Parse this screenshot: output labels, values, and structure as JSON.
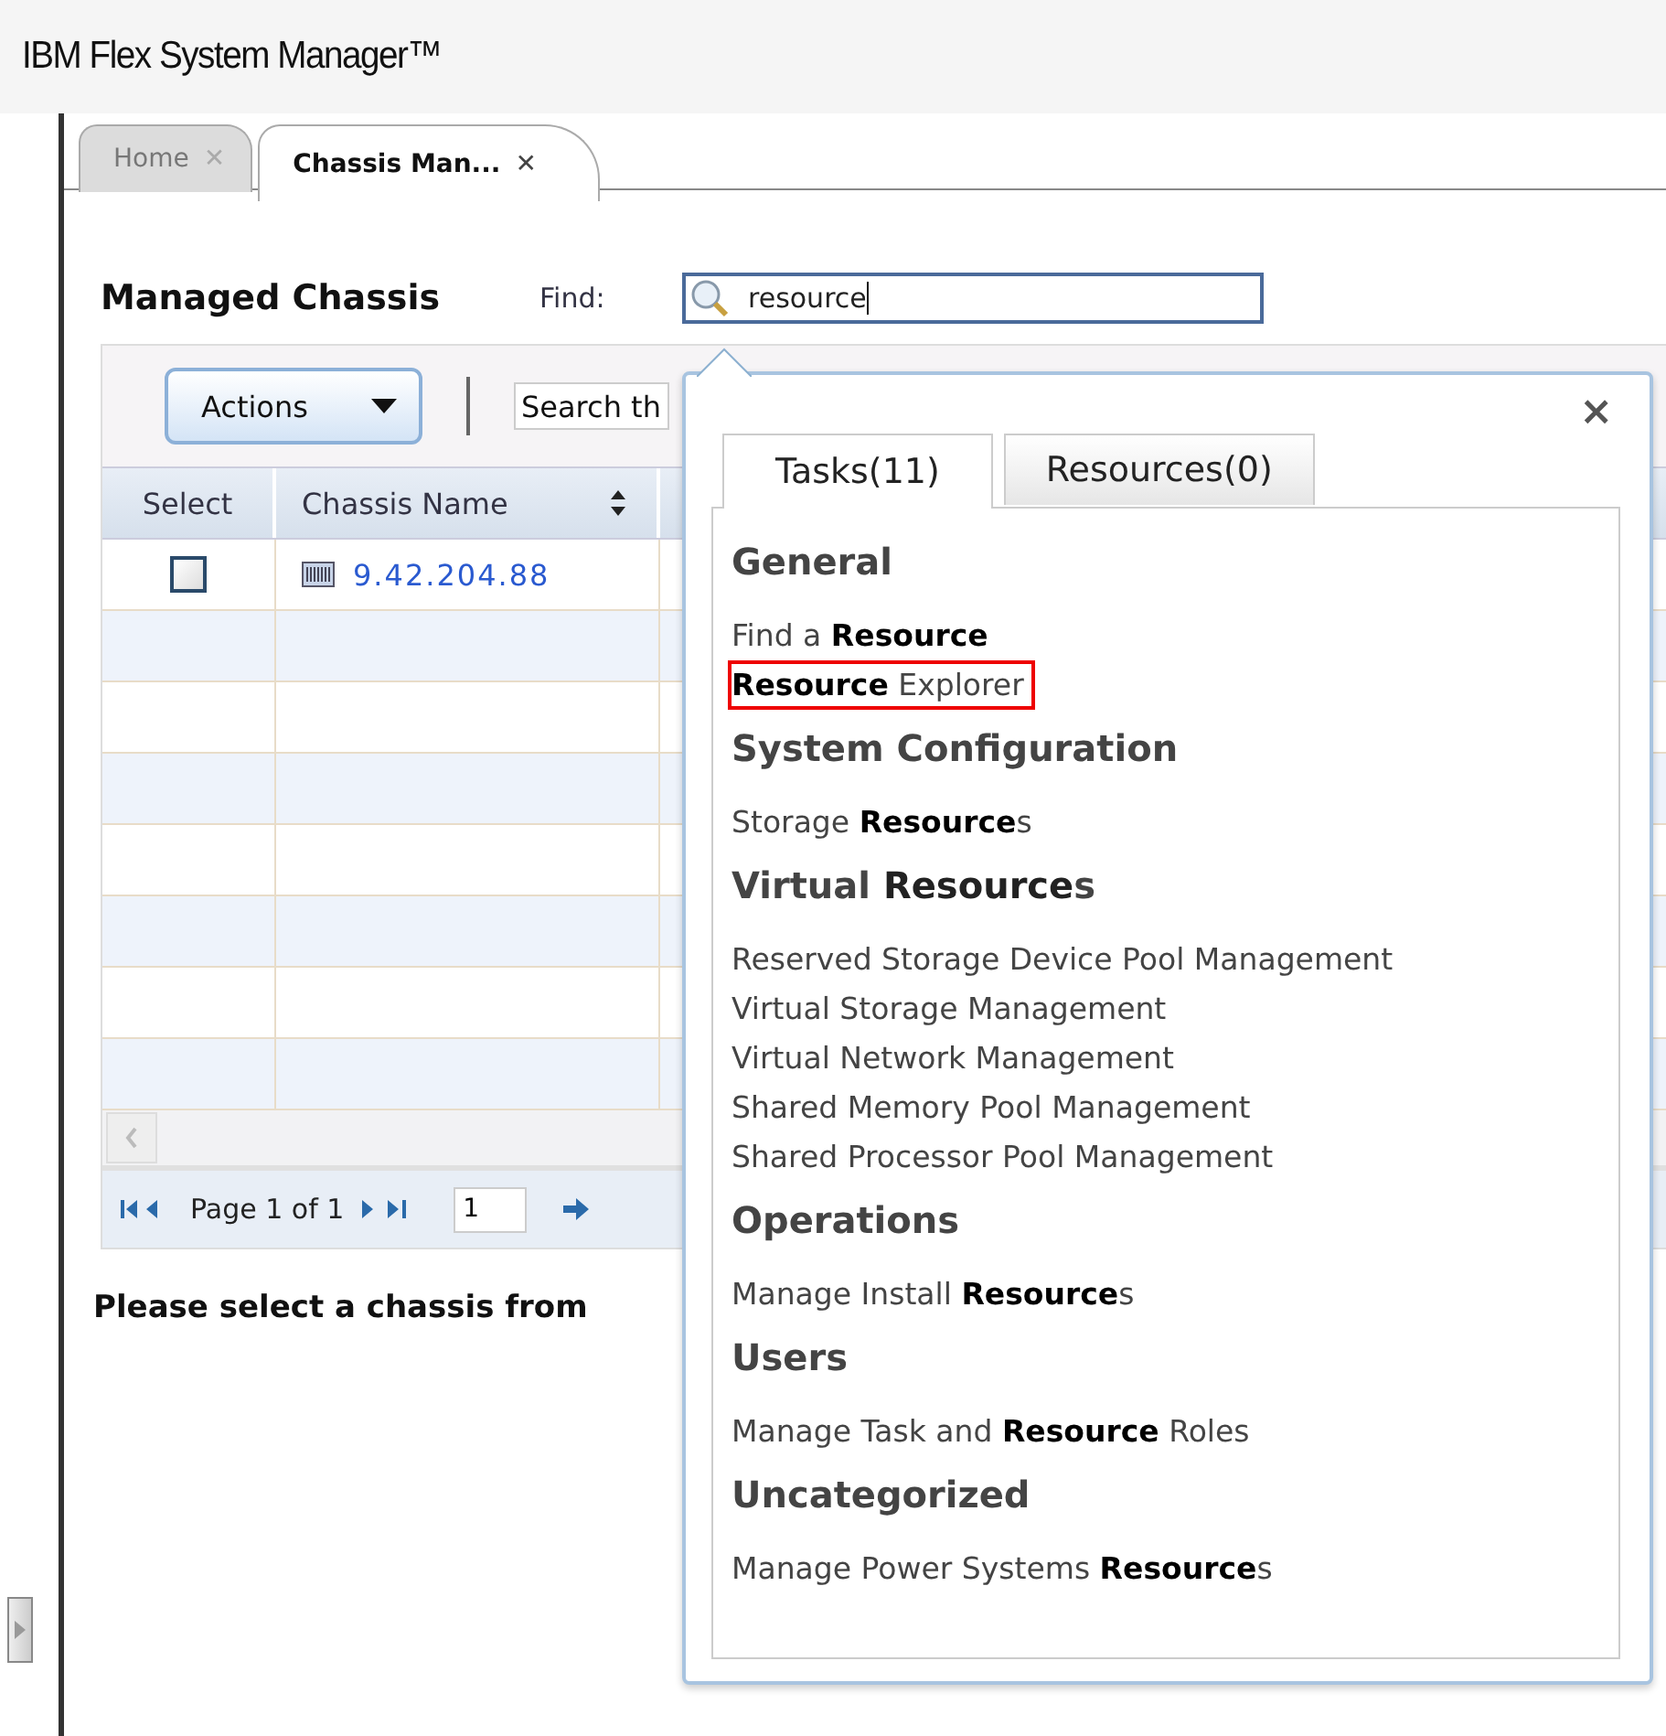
{
  "header": {
    "title": "IBM Flex System Manager™"
  },
  "tabs": [
    {
      "label": "Home",
      "close": "✕",
      "selected": false
    },
    {
      "label": "Chassis Man...",
      "close": "✕",
      "selected": true
    }
  ],
  "page": {
    "title": "Managed Chassis",
    "find_label": "Find:",
    "find": {
      "value": "resource"
    }
  },
  "toolbar": {
    "actions": "Actions",
    "search": {
      "placeholder": "Search th"
    }
  },
  "table": {
    "columns": [
      {
        "label": "Select",
        "sortable": false
      },
      {
        "label": "Chassis Name",
        "sortable": true
      }
    ],
    "rows": [
      {
        "checked": false,
        "name": "9.42.204.88"
      },
      {},
      {},
      {},
      {},
      {},
      {},
      {}
    ]
  },
  "pager": {
    "text": "Page 1 of 1",
    "page": "1"
  },
  "message": "Please select a chassis from",
  "popup": {
    "close": "×",
    "tabs": [
      {
        "label": "Tasks(11)",
        "selected": true
      },
      {
        "label": "Resources(0)",
        "selected": false
      }
    ],
    "sections": [
      {
        "title": "General",
        "items": [
          {
            "text": "Find a **Resource**",
            "selected": false
          },
          {
            "text": "**Resource** Explorer",
            "selected": true
          }
        ]
      },
      {
        "title": "System Configuration",
        "items": [
          {
            "text": "Storage **Resource**s",
            "selected": false
          }
        ]
      },
      {
        "title": "Virtual **Resource**s",
        "items": [
          {
            "text": "Reserved Storage Device Pool Management",
            "selected": false
          },
          {
            "text": "Virtual Storage Management",
            "selected": false
          },
          {
            "text": "Virtual Network Management",
            "selected": false
          },
          {
            "text": "Shared Memory Pool Management",
            "selected": false
          },
          {
            "text": "Shared Processor Pool Management",
            "selected": false
          }
        ]
      },
      {
        "title": "Operations",
        "items": [
          {
            "text": "Manage Install **Resource**s",
            "selected": false
          }
        ]
      },
      {
        "title": "Users",
        "items": [
          {
            "text": "Manage Task and **Resource** Roles",
            "selected": false
          }
        ]
      },
      {
        "title": "Uncategorized",
        "items": [
          {
            "text": "Manage Power Systems **Resource**s",
            "selected": false
          }
        ]
      }
    ]
  }
}
